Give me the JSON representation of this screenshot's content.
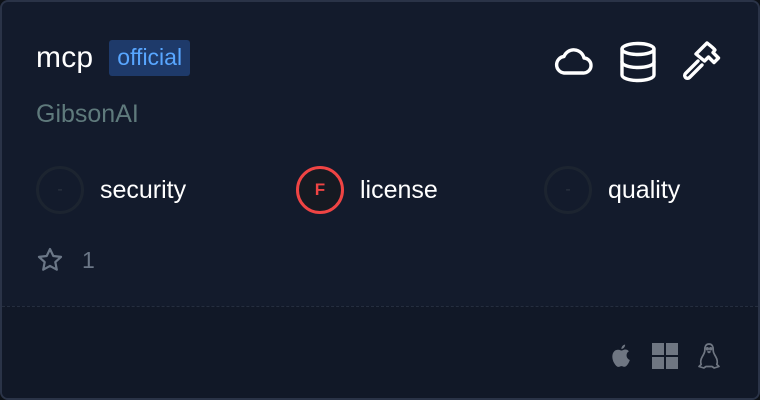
{
  "server": {
    "name": "mcp",
    "badge": "official",
    "author": "GibsonAI"
  },
  "capability_icons": [
    "cloud-icon",
    "database-icon",
    "hammer-icon"
  ],
  "scores": [
    {
      "label": "security",
      "grade": "-",
      "status": "none"
    },
    {
      "label": "license",
      "grade": "F",
      "status": "fail"
    },
    {
      "label": "quality",
      "grade": "-",
      "status": "none"
    }
  ],
  "stars": {
    "count": "1"
  },
  "platforms": [
    "apple-icon",
    "windows-icon",
    "linux-icon"
  ],
  "colors": {
    "card_bg": "#131b2c",
    "badge_bg": "#1e3a6a",
    "badge_text": "#58a6ff",
    "fail": "#ef4444"
  }
}
